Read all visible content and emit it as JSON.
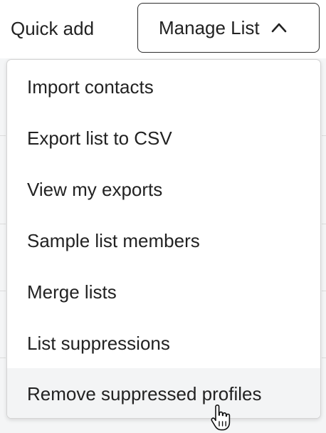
{
  "header": {
    "quick_add_label": "Quick add",
    "manage_list_label": "Manage List"
  },
  "menu": {
    "items": [
      {
        "label": "Import contacts"
      },
      {
        "label": "Export list to CSV"
      },
      {
        "label": "View my exports"
      },
      {
        "label": "Sample list members"
      },
      {
        "label": "Merge lists"
      },
      {
        "label": "List suppressions"
      },
      {
        "label": "Remove suppressed profiles",
        "hovered": true
      }
    ]
  },
  "icons": {
    "manage_list_toggle": "chevron-up-icon",
    "pointer": "hand-pointer-cursor-icon"
  },
  "colors": {
    "text": "#222222",
    "button_border": "#2d2d2d",
    "menu_border": "#d4d4d4",
    "hover_bg": "#f3f4f5",
    "page_bg": "#f4f5f6"
  }
}
